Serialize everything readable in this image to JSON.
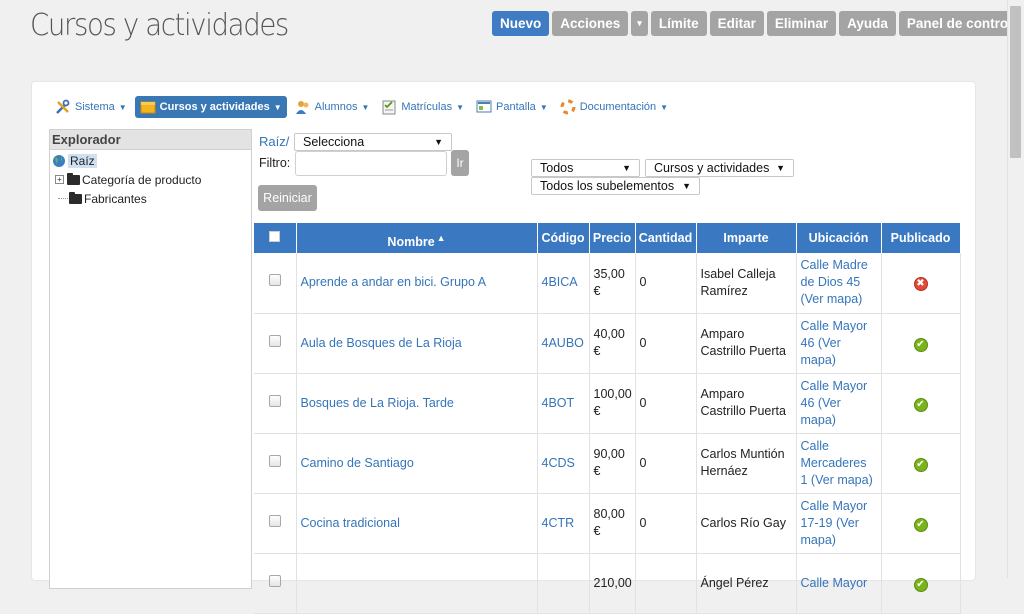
{
  "page": {
    "title": "Cursos y actividades"
  },
  "toolbar": {
    "nuevo": "Nuevo",
    "acciones": "Acciones",
    "acciones_caret": "▾",
    "limite": "Límite",
    "editar": "Editar",
    "eliminar": "Eliminar",
    "ayuda": "Ayuda",
    "panel": "Panel de control"
  },
  "menu": [
    {
      "label": "Sistema",
      "icon": "tools-icon"
    },
    {
      "label": "Cursos y actividades",
      "icon": "box-icon"
    },
    {
      "label": "Alumnos",
      "icon": "users-icon"
    },
    {
      "label": "Matrículas",
      "icon": "checklist-icon"
    },
    {
      "label": "Pantalla",
      "icon": "screen-icon"
    },
    {
      "label": "Documentación",
      "icon": "lifebuoy-icon"
    }
  ],
  "explorer": {
    "title": "Explorador",
    "root": "Raíz",
    "items": [
      {
        "label": "Categoría de producto",
        "expander": "+"
      },
      {
        "label": "Fabricantes"
      }
    ]
  },
  "filters": {
    "breadcrumb": "Raíz/",
    "select_label": "Selecciona",
    "filter_label": "Filtro:",
    "filter_value": "",
    "ir": "Ir",
    "reset": "Reiniciar",
    "todos": "Todos",
    "categoria": "Cursos y actividades",
    "subelementos": "Todos los subelementos"
  },
  "table": {
    "headers": {
      "nombre": "Nombre",
      "codigo": "Código",
      "precio": "Precio",
      "cantidad": "Cantidad",
      "imparte": "Imparte",
      "ubicacion": "Ubicación",
      "publicado": "Publicado"
    },
    "sort_indicator": "▲",
    "rows": [
      {
        "nombre": "Aprende a andar en bici. Grupo A",
        "codigo": "4BICA",
        "precio": "35,00 €",
        "cantidad": "0",
        "imparte": "Isabel Calleja Ramírez",
        "ubicacion": "Calle Madre de Dios 45 (Ver mapa)",
        "publicado": false
      },
      {
        "nombre": "Aula de Bosques de La Rioja",
        "codigo": "4AUBO",
        "precio": "40,00 €",
        "cantidad": "0",
        "imparte": "Amparo Castrillo Puerta",
        "ubicacion": "Calle Mayor 46 (Ver mapa)",
        "publicado": true
      },
      {
        "nombre": "Bosques de La Rioja. Tarde",
        "codigo": "4BOT",
        "precio": "100,00 €",
        "cantidad": "0",
        "imparte": "Amparo Castrillo Puerta",
        "ubicacion": "Calle Mayor 46 (Ver mapa)",
        "publicado": true
      },
      {
        "nombre": "Camino de Santiago",
        "codigo": "4CDS",
        "precio": "90,00 €",
        "cantidad": "0",
        "imparte": "Carlos Muntión Hernáez",
        "ubicacion": "Calle Mercaderes 1 (Ver mapa)",
        "publicado": true
      },
      {
        "nombre": "Cocina tradicional",
        "codigo": "4CTR",
        "precio": "80,00 €",
        "cantidad": "0",
        "imparte": "Carlos Río Gay",
        "ubicacion": "Calle Mayor 17-19 (Ver mapa)",
        "publicado": true
      },
      {
        "nombre": "",
        "codigo": "",
        "precio": "210,00",
        "cantidad": "",
        "imparte": "Ángel Pérez",
        "ubicacion": "Calle Mayor",
        "publicado": true
      }
    ]
  },
  "colors": {
    "primary": "#3f7cc3",
    "button_gray": "#a4a4a4",
    "link": "#3475ba",
    "header_blue": "#3a78c2",
    "ok_green": "#7bb31c",
    "error_red": "#e04a3a"
  }
}
